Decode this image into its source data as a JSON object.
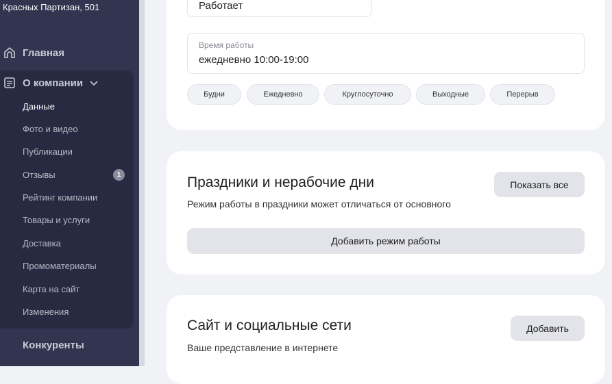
{
  "sidebar": {
    "address": "Красных Партизан, 501",
    "home": "Главная",
    "about": "О компании",
    "items": [
      {
        "label": "Данные"
      },
      {
        "label": "Фото и видео"
      },
      {
        "label": "Публикации"
      },
      {
        "label": "Отзывы",
        "badge": "1"
      },
      {
        "label": "Рейтинг компании"
      },
      {
        "label": "Товары и услуги"
      },
      {
        "label": "Доставка"
      },
      {
        "label": "Промоматериалы"
      },
      {
        "label": "Карта на сайт"
      },
      {
        "label": "Изменения"
      }
    ],
    "competitors": "Конкуренты"
  },
  "hours": {
    "status_value": "Работает",
    "time_label": "Время работы",
    "time_value": "ежедневно 10:00-19:00",
    "chips": [
      "Будни",
      "Ежедневно",
      "Круглосуточно",
      "Выходные",
      "Перерыв"
    ]
  },
  "holidays": {
    "title": "Праздники и нерабочие дни",
    "desc": "Режим работы в праздники может отличаться от основного",
    "show_all": "Показать все",
    "add": "Добавить режим работы"
  },
  "site": {
    "title": "Сайт и социальные сети",
    "desc": "Ваше представление в интернете",
    "add": "Добавить"
  }
}
